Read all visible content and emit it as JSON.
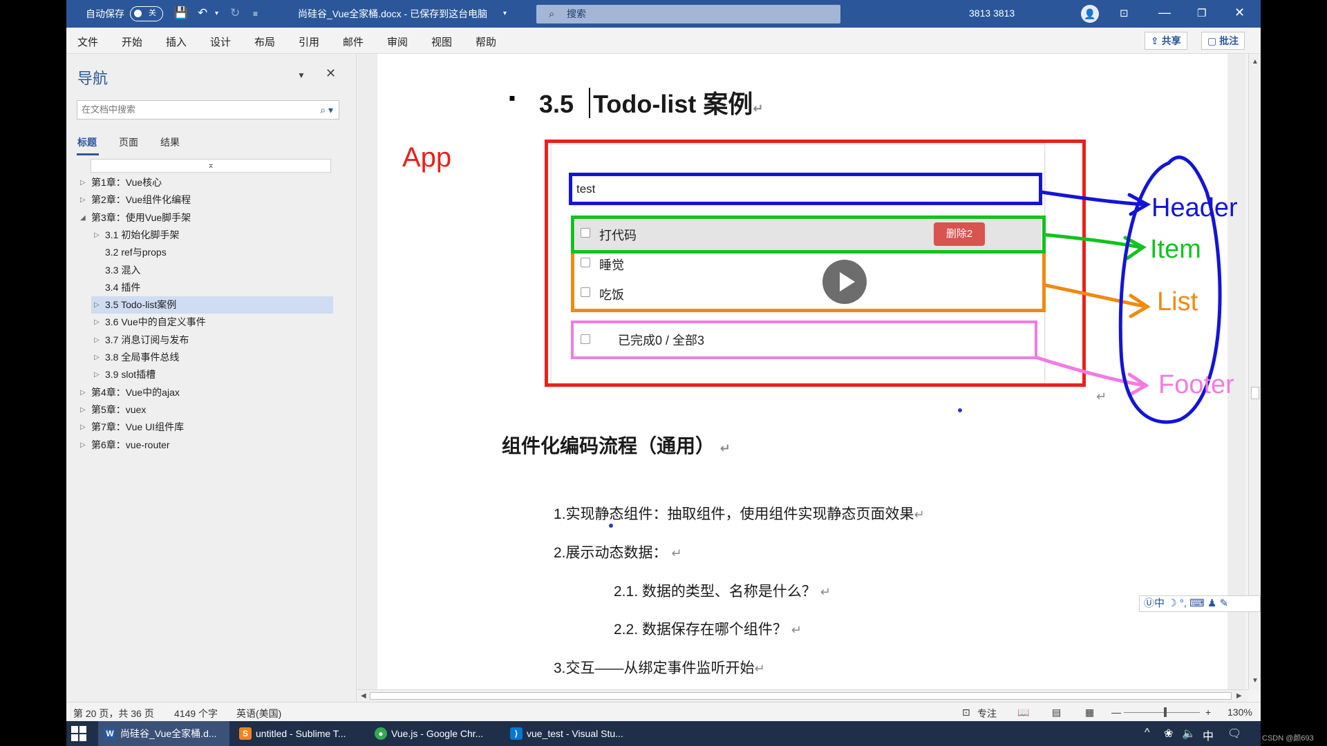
{
  "titlebar": {
    "autosave_label": "自动保存",
    "autosave_state": "关",
    "doc_title": "尚硅谷_Vue全家桶.docx - 已保存到这台电脑",
    "search_placeholder": "搜索",
    "user": "3813 3813"
  },
  "menu": {
    "items": [
      "文件",
      "开始",
      "插入",
      "设计",
      "布局",
      "引用",
      "邮件",
      "审阅",
      "视图",
      "帮助"
    ],
    "share": "共享",
    "comment": "批注"
  },
  "nav": {
    "title": "导航",
    "search_placeholder": "在文档中搜索",
    "tabs": [
      "标题",
      "页面",
      "结果"
    ],
    "tree": [
      {
        "label": "第1章：Vue核心",
        "level": 0,
        "arrow": "▷"
      },
      {
        "label": "第2章：Vue组件化编程",
        "level": 0,
        "arrow": "▷"
      },
      {
        "label": "第3章：使用Vue脚手架",
        "level": 0,
        "arrow": "◢"
      },
      {
        "label": "3.1 初始化脚手架",
        "level": 1,
        "arrow": "▷"
      },
      {
        "label": "3.2 ref与props",
        "level": 1,
        "arrow": ""
      },
      {
        "label": "3.3 混入",
        "level": 1,
        "arrow": ""
      },
      {
        "label": "3.4 插件",
        "level": 1,
        "arrow": ""
      },
      {
        "label": "3.5 Todo-list案例",
        "level": 1,
        "arrow": "▷",
        "selected": true
      },
      {
        "label": "3.6 Vue中的自定义事件",
        "level": 1,
        "arrow": "▷"
      },
      {
        "label": "3.7 消息订阅与发布",
        "level": 1,
        "arrow": "▷"
      },
      {
        "label": "3.8 全局事件总线",
        "level": 1,
        "arrow": "▷"
      },
      {
        "label": "3.9 slot插槽",
        "level": 1,
        "arrow": "▷"
      },
      {
        "label": "第4章：Vue中的ajax",
        "level": 0,
        "arrow": "▷"
      },
      {
        "label": "第5章：vuex",
        "level": 0,
        "arrow": "▷"
      },
      {
        "label": "第7章：Vue UI组件库",
        "level": 0,
        "arrow": "▷"
      },
      {
        "label": "第6章：vue-router",
        "level": 0,
        "arrow": "▷"
      }
    ]
  },
  "doc": {
    "heading_num": "3.5",
    "heading_text": "Todo-list 案例",
    "pilcrow": "↵",
    "app_label": "App",
    "todo": {
      "input_value": "test",
      "items": [
        "打代码",
        "睡觉",
        "吃饭"
      ],
      "delete_label": "删除2",
      "footer_text": "已完成0 / 全部3"
    },
    "annotations": {
      "header": "Header",
      "item": "Item",
      "list": "List",
      "footer": "Footer"
    },
    "section_title": "组件化编码流程（通用）",
    "steps": [
      "1.实现静态组件：抽取组件，使用组件实现静态页面效果",
      "2.展示动态数据：",
      "2.1.  数据的类型、名称是什么？",
      "2.2.  数据保存在哪个组件？",
      "3.交互——从绑定事件监听开始"
    ]
  },
  "colors": {
    "app": "#e8211c",
    "header": "#1414d6",
    "item": "#12c21e",
    "list": "#ef8a12",
    "footer": "#f27be0",
    "accent": "#2b579a"
  },
  "ime": "中",
  "status": {
    "page": "第 20 页，共 36 页",
    "words": "4149 个字",
    "lang": "英语(美国)",
    "focus": "专注",
    "zoom": "130%"
  },
  "taskbar": {
    "items": [
      "尚硅谷_Vue全家桶.d...",
      "untitled - Sublime T...",
      "Vue.js - Google Chr...",
      "vue_test - Visual Stu..."
    ],
    "ime": "中"
  },
  "watermark": "CSDN @颜693"
}
